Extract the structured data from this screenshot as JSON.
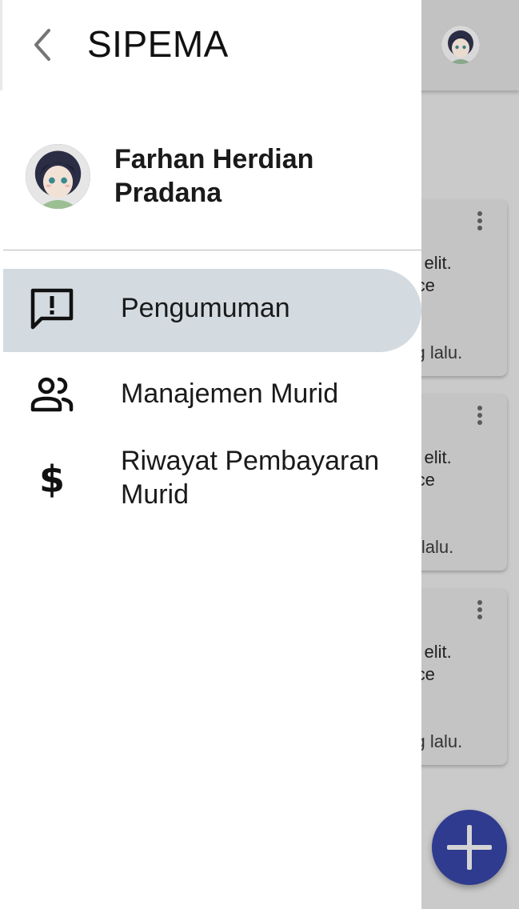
{
  "app": {
    "title": "SIPEMA"
  },
  "user": {
    "name": "Farhan Herdian Pradana"
  },
  "nav": {
    "items": [
      {
        "label": "Pengumuman",
        "icon": "announcement-icon",
        "active": true
      },
      {
        "label": "Manajemen Murid",
        "icon": "people-icon",
        "active": false
      },
      {
        "label": "Riwayat Pembayaran Murid",
        "icon": "dollar-icon",
        "active": false
      }
    ]
  },
  "background": {
    "cards": [
      {
        "line1": "cing elit.",
        "line2": "Fusce",
        "time": "yang lalu."
      },
      {
        "line1": "cing elit.",
        "line2": "Fusce",
        "time": "ang lalu."
      },
      {
        "line1": "cing elit.",
        "line2": "Fusce",
        "time": "yang lalu."
      }
    ]
  },
  "colors": {
    "accent": "#2e3b8f",
    "active_item": "#d3dbe0",
    "scrim": "#cacaca"
  }
}
